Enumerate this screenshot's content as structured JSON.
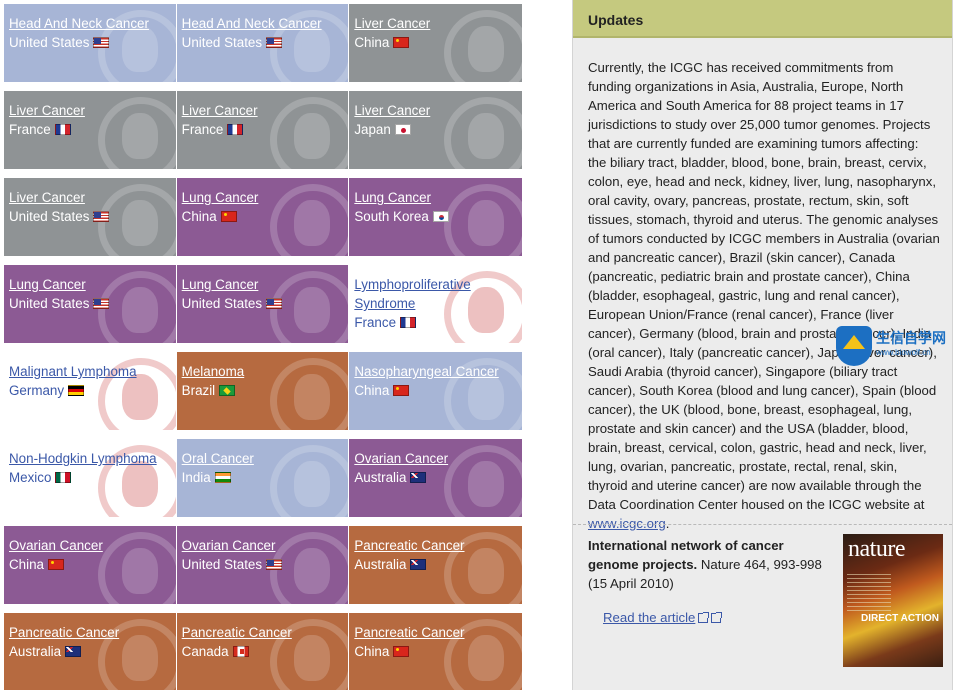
{
  "tiles": [
    [
      {
        "name": "Head And Neck Cancer",
        "country": "United States",
        "flag": "us",
        "color": "blue"
      },
      {
        "name": "Head And Neck Cancer",
        "country": "United States",
        "flag": "us",
        "color": "blue"
      },
      {
        "name": "Liver Cancer",
        "country": "China",
        "flag": "cn",
        "color": "grey"
      }
    ],
    [
      {
        "name": "Liver Cancer",
        "country": "France",
        "flag": "fr",
        "color": "grey"
      },
      {
        "name": "Liver Cancer",
        "country": "France",
        "flag": "fr",
        "color": "grey"
      },
      {
        "name": "Liver Cancer",
        "country": "Japan",
        "flag": "jp",
        "color": "grey"
      }
    ],
    [
      {
        "name": "Liver Cancer",
        "country": "United States",
        "flag": "us",
        "color": "grey"
      },
      {
        "name": "Lung Cancer",
        "country": "China",
        "flag": "cn",
        "color": "purple"
      },
      {
        "name": "Lung Cancer",
        "country": "South Korea",
        "flag": "kr",
        "color": "purple"
      }
    ],
    [
      {
        "name": "Lung Cancer",
        "country": "United States",
        "flag": "us",
        "color": "purple"
      },
      {
        "name": "Lung Cancer",
        "country": "United States",
        "flag": "us",
        "color": "purple"
      },
      {
        "name": "Lymphoproliferative Syndrome",
        "country": "France",
        "flag": "fr",
        "color": "white"
      }
    ],
    [
      {
        "name": "Malignant Lymphoma",
        "country": "Germany",
        "flag": "de",
        "color": "white"
      },
      {
        "name": "Melanoma",
        "country": "Brazil",
        "flag": "br",
        "color": "brown"
      },
      {
        "name": "Nasopharyngeal Cancer",
        "country": "China",
        "flag": "cn",
        "color": "blue"
      }
    ],
    [
      {
        "name": "Non-Hodgkin Lymphoma",
        "country": "Mexico",
        "flag": "mx",
        "color": "white"
      },
      {
        "name": "Oral Cancer",
        "country": "India",
        "flag": "in",
        "color": "blue"
      },
      {
        "name": "Ovarian Cancer",
        "country": "Australia",
        "flag": "au",
        "color": "purple"
      }
    ],
    [
      {
        "name": "Ovarian Cancer",
        "country": "China",
        "flag": "cn",
        "color": "purple"
      },
      {
        "name": "Ovarian Cancer",
        "country": "United States",
        "flag": "us",
        "color": "purple"
      },
      {
        "name": "Pancreatic Cancer",
        "country": "Australia",
        "flag": "au",
        "color": "brown"
      }
    ],
    [
      {
        "name": "Pancreatic Cancer",
        "country": "Australia",
        "flag": "au",
        "color": "brown"
      },
      {
        "name": "Pancreatic Cancer",
        "country": "Canada",
        "flag": "ca",
        "color": "brown"
      },
      {
        "name": "Pancreatic Cancer",
        "country": "China",
        "flag": "cn",
        "color": "brown"
      }
    ]
  ],
  "updates": {
    "title": "Updates",
    "body": "Currently, the ICGC has received commitments from funding organizations in Asia, Australia, Europe, North America and South America for 88 project teams in 17 jurisdictions to study over 25,000 tumor genomes. Projects that are currently funded are examining tumors affecting: the biliary tract, bladder, blood, bone, brain, breast, cervix, colon, eye, head and neck, kidney, liver, lung, nasopharynx, oral cavity, ovary, pancreas, prostate, rectum, skin, soft tissues, stomach, thyroid and uterus. The genomic analyses of tumors conducted by ICGC members in Australia (ovarian and pancreatic cancer), Brazil (skin cancer), Canada (pancreatic, pediatric brain and prostate cancer), China (bladder, esophageal, gastric, lung and renal cancer), European Union/France (renal cancer), France (liver cancer), Germany (blood, brain and prostate cancer), India (oral cancer), Italy (pancreatic cancer), Japan (liver cancer), Saudi Arabia (thyroid cancer), Singapore (biliary tract cancer), South Korea (blood and lung cancer), Spain (blood cancer), the UK (blood, bone, breast, esophageal, lung, prostate and skin cancer) and the USA (bladder, blood, brain, breast, cervical, colon, gastric, head and neck, liver, lung, ovarian, pancreatic, prostate, rectal, renal, skin, thyroid and uterine cancer) are now available through the Data Coordination Center housed on the ICGC website at",
    "link": "www.icgc.org",
    "end": "."
  },
  "article": {
    "title": "International network of cancer genome projects.",
    "citation": " Nature 464, 993-998 (15 April 2010)",
    "read_label": "Read the article"
  },
  "cover": {
    "masthead": "nature",
    "headline": "DIRECT ACTION"
  },
  "watermark": {
    "title": "生信自学网",
    "subtitle": "www.biowolf.cn"
  }
}
